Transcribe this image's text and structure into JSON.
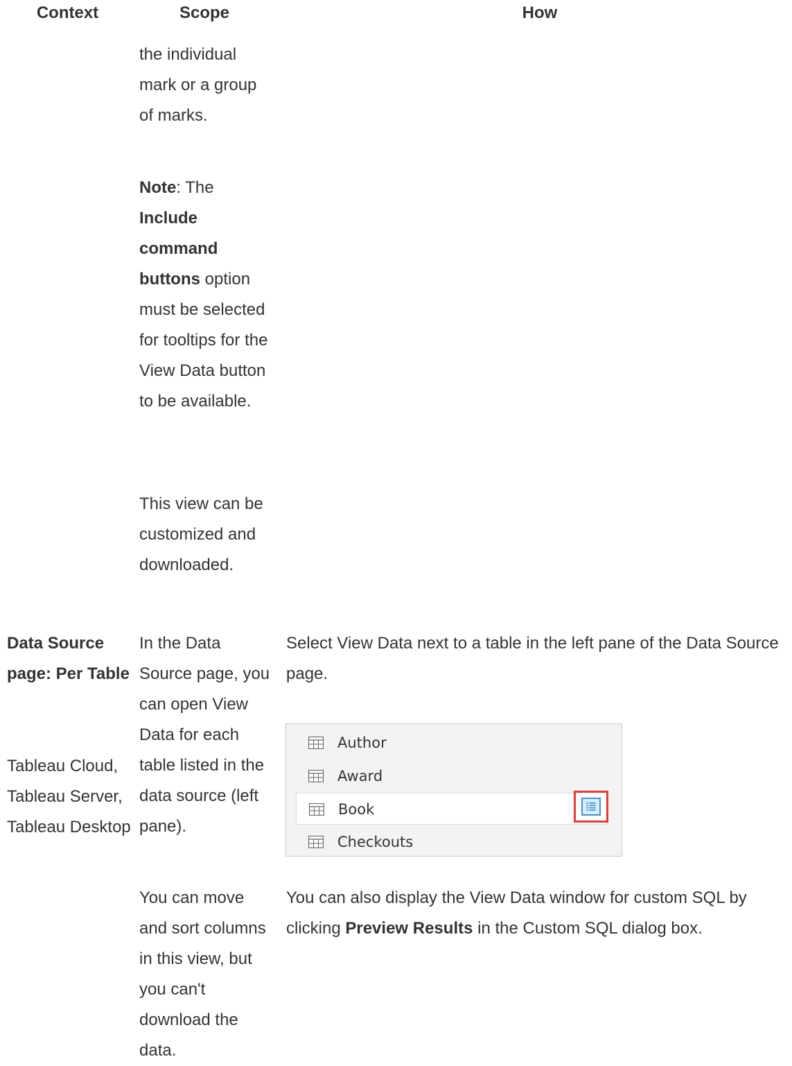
{
  "headers": {
    "context": "Context",
    "scope": "Scope",
    "how": "How"
  },
  "row1": {
    "scope_block1": "the individual mark or a group of marks.",
    "note_label": "Note",
    "note_colon": ": The",
    "note_bold": "Include command buttons",
    "note_rest": " option must be selected for tooltips for the View Data button to be available.",
    "scope_block3": "This view can be customized and downloaded."
  },
  "row2": {
    "context_title": "Data Source page: Per Table",
    "context_products": "Tableau Cloud, Tableau Server, Tableau Desktop",
    "scope_a": "In the Data Source page, you can open View Data for each table listed in the data source (left pane).",
    "scope_b": "You can move and sort columns in this view, but you can't download the data.",
    "how_text1": "Select View Data next to a table in the left pane of the Data Source page.",
    "how_text2_pre": "You can also display the View Data window for custom SQL by clicking ",
    "how_text2_bold": "Preview Results",
    "how_text2_post": " in the Custom SQL dialog box.",
    "tables": [
      "Author",
      "Award",
      "Book",
      "Checkouts"
    ],
    "selected_table": "Book"
  },
  "colors": {
    "text": "#333333",
    "highlight_border": "#e33a3a",
    "button_blue": "#3f93d8"
  }
}
